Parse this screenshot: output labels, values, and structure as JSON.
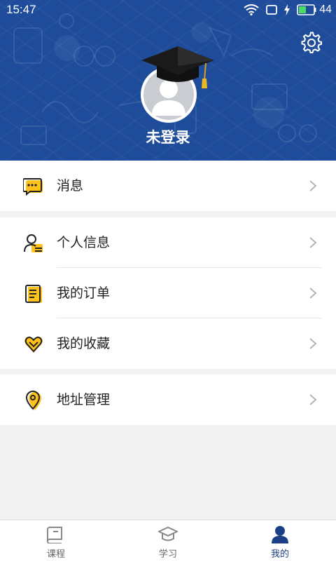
{
  "status_bar": {
    "time": "15:47",
    "battery": "44"
  },
  "profile": {
    "login_status": "未登录"
  },
  "menu": {
    "group1": [
      {
        "label": "消息",
        "icon": "message-icon"
      }
    ],
    "group2": [
      {
        "label": "个人信息",
        "icon": "profile-info-icon"
      },
      {
        "label": "我的订单",
        "icon": "order-icon"
      },
      {
        "label": "我的收藏",
        "icon": "heart-icon"
      }
    ],
    "group3": [
      {
        "label": "地址管理",
        "icon": "location-pin-icon"
      }
    ]
  },
  "bottom_nav": {
    "tabs": [
      {
        "label": "课程",
        "icon": "book-icon"
      },
      {
        "label": "学习",
        "icon": "graduation-cap-icon"
      },
      {
        "label": "我的",
        "icon": "user-icon",
        "active": true
      }
    ]
  },
  "colors": {
    "header_bg": "#1e4c9a",
    "accent": "#ffc21a",
    "active_tab": "#1a3f86"
  }
}
